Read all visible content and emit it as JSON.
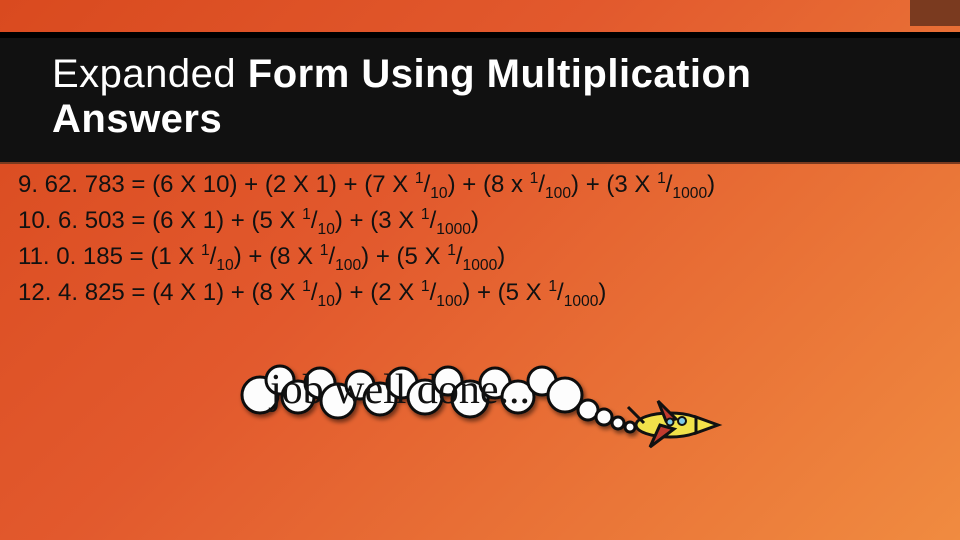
{
  "title_prefix": "Expanded ",
  "title_bold": "Form Using Multiplication Answers",
  "lines": [
    {
      "num": "9.",
      "value": "62. 783",
      "terms": [
        {
          "coef": "6",
          "op": "X",
          "mult": "10"
        },
        {
          "coef": "2",
          "op": "X",
          "mult": "1"
        },
        {
          "coef": "7",
          "op": "X",
          "frac_num": "1",
          "frac_den": "10"
        },
        {
          "coef": "8",
          "op": "x",
          "frac_num": "1",
          "frac_den": "100"
        },
        {
          "coef": "3",
          "op": "X",
          "frac_num": "1",
          "frac_den": "1000"
        }
      ]
    },
    {
      "num": "10.",
      "value": "6. 503",
      "terms": [
        {
          "coef": "6",
          "op": "X",
          "mult": "1"
        },
        {
          "coef": "5",
          "op": "X",
          "frac_num": "1",
          "frac_den": "10"
        },
        {
          "coef": "3",
          "op": "X",
          "frac_num": "1",
          "frac_den": "1000"
        }
      ]
    },
    {
      "num": "11.",
      "value": "0. 185",
      "terms": [
        {
          "coef": "1",
          "op": "X",
          "frac_num": "1",
          "frac_den": "10"
        },
        {
          "coef": "8",
          "op": "X",
          "frac_num": "1",
          "frac_den": "100"
        },
        {
          "coef": "5",
          "op": "X",
          "frac_num": "1",
          "frac_den": "1000"
        }
      ]
    },
    {
      "num": "12.",
      "value": "4. 825",
      "terms": [
        {
          "coef": "4",
          "op": "X",
          "mult": "1"
        },
        {
          "coef": "8",
          "op": "X",
          "frac_num": "1",
          "frac_den": "10"
        },
        {
          "coef": "2",
          "op": "X",
          "frac_num": "1",
          "frac_den": "100"
        },
        {
          "coef": "5",
          "op": "X",
          "frac_num": "1",
          "frac_den": "1000"
        }
      ]
    }
  ],
  "illustration_caption": "job well done...",
  "colors": {
    "band": "#111111",
    "accent": "#7a3a1f",
    "bg_start": "#d94a1f",
    "bg_end": "#f08b40"
  }
}
